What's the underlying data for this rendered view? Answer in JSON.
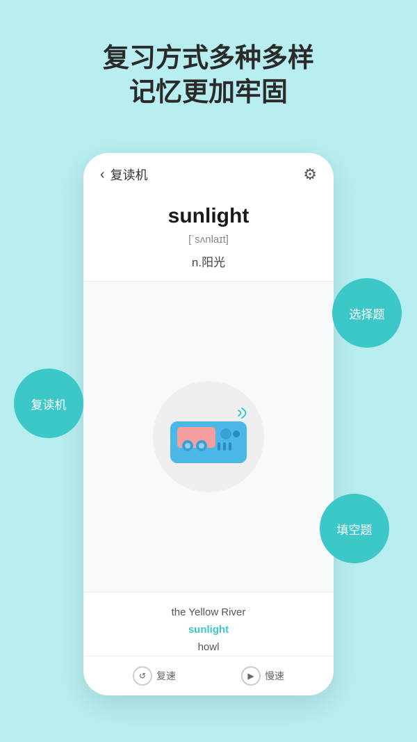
{
  "header": {
    "line1": "复习方式多种多样",
    "line2": "记忆更加牢固"
  },
  "phone": {
    "topbar": {
      "back_label": "复读机",
      "settings_icon": "⚙"
    },
    "word": {
      "english": "sunlight",
      "phonetic": "[ˈsʌnlaɪt]",
      "meaning": "n.阳光"
    },
    "wordList": [
      {
        "text": "the Yellow River",
        "highlighted": false
      },
      {
        "text": "sunlight",
        "highlighted": true
      },
      {
        "text": "howl",
        "highlighted": false
      }
    ],
    "actions": [
      {
        "icon": "↺",
        "label": "复速"
      },
      {
        "icon": "▶",
        "label": "慢速"
      }
    ]
  },
  "bubbles": {
    "fuzhuji": "复读机",
    "xuanzeti": "选择题",
    "tiankongti": "填空题"
  }
}
